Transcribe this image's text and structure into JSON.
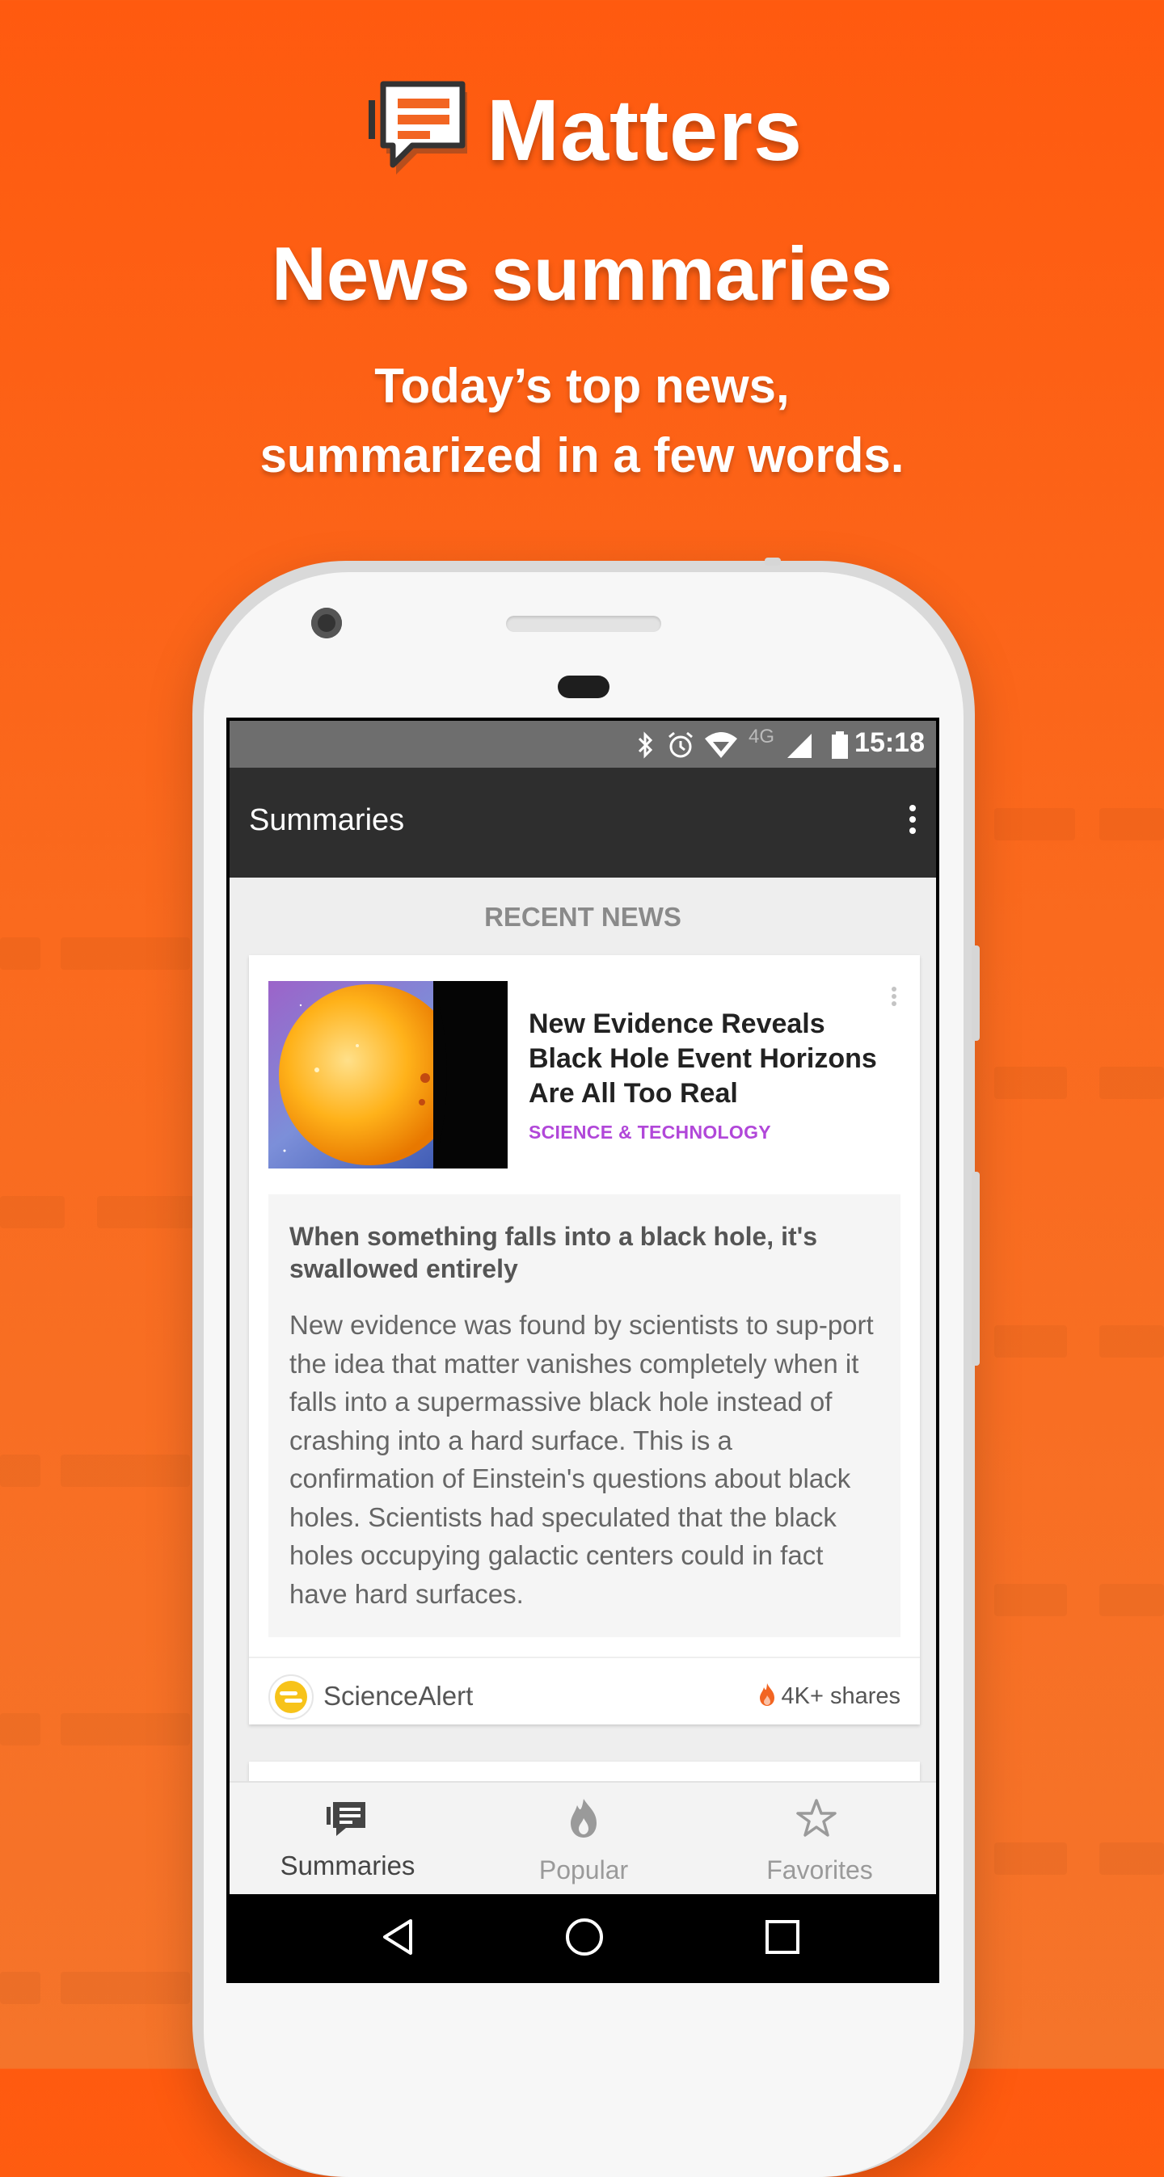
{
  "hero": {
    "app_name": "Matters",
    "headline": "News summaries",
    "subtitle_line1": "Today’s top news,",
    "subtitle_line2": "summarized in a few words."
  },
  "status_bar": {
    "time": "15:18",
    "network": "4G",
    "icons": [
      "bluetooth-icon",
      "alarm-icon",
      "wifi-icon",
      "signal-icon",
      "battery-icon"
    ]
  },
  "app_bar": {
    "title": "Summaries",
    "menu_icon": "more-vert-icon"
  },
  "feed": {
    "section_title": "RECENT NEWS",
    "card": {
      "title": "New Evidence Reveals Black Hole Event Horizons Are All Too Real",
      "category": "SCIENCE & TECHNOLOGY",
      "category_color": "#b147d9",
      "summary_headline": "When something falls into a black hole, it's swallowed entirely",
      "summary_body": "New evidence was found by scientists to sup-port the idea that matter vanishes completely when it falls into a supermassive black hole instead of crashing into a hard surface. This is a confirmation of Einstein's questions about black holes. Scientists had speculated that the black holes occupying galactic centers could in fact have hard surfaces.",
      "source": "ScienceAlert",
      "shares": "4K+ shares"
    }
  },
  "bottom_nav": {
    "tabs": [
      {
        "label": "Summaries",
        "icon": "summaries-icon",
        "active": true
      },
      {
        "label": "Popular",
        "icon": "flame-icon",
        "active": false
      },
      {
        "label": "Favorites",
        "icon": "star-icon",
        "active": false
      }
    ]
  },
  "colors": {
    "background": "#ff5a0f",
    "app_bar": "#2e2e2e",
    "status_bar": "#6e6e6e",
    "accent_flame": "#f26522"
  }
}
